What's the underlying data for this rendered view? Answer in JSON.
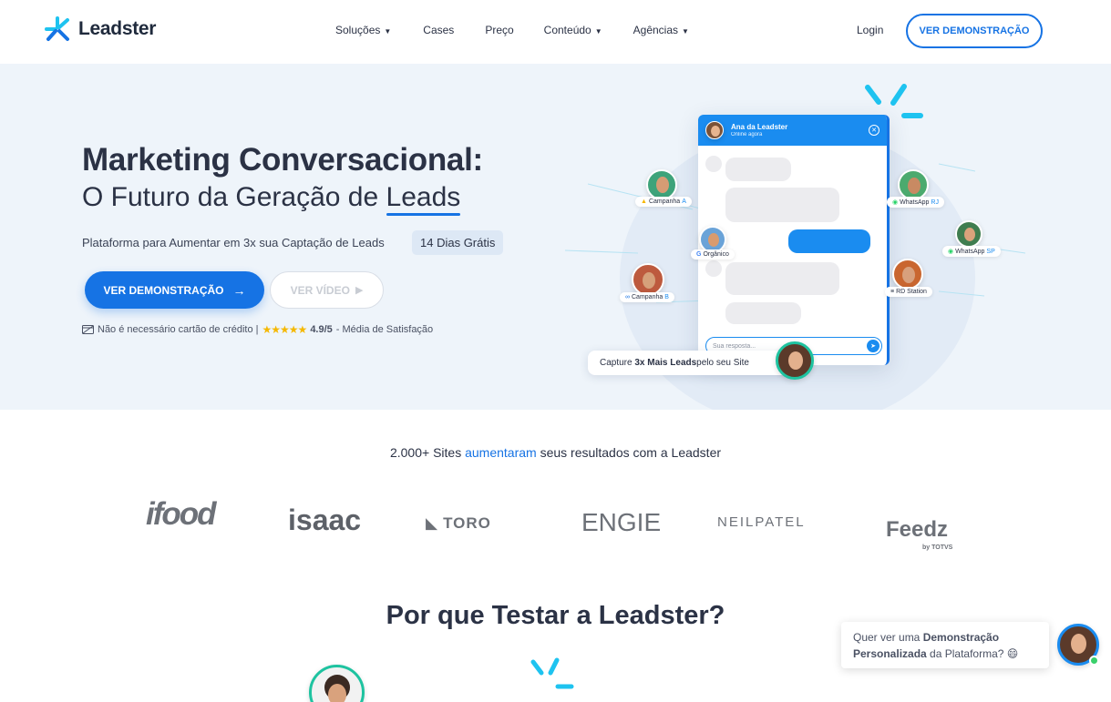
{
  "header": {
    "logo_text": "Leadster",
    "nav": [
      {
        "label": "Soluções",
        "dropdown": true
      },
      {
        "label": "Cases",
        "dropdown": false
      },
      {
        "label": "Preço",
        "dropdown": false
      },
      {
        "label": "Conteúdo",
        "dropdown": true
      },
      {
        "label": "Agências",
        "dropdown": true
      }
    ],
    "login": "Login",
    "demo_button": "VER DEMONSTRAÇÃO"
  },
  "hero": {
    "title_line1": "Marketing Conversacional:",
    "title_line2_prefix": "O Futuro da Geração de ",
    "title_line2_highlight": "Leads",
    "subtitle": "Plataforma para Aumentar em 3x sua Captação de Leads",
    "badge": "14 Dias Grátis",
    "primary_button": "VER DEMONSTRAÇÃO",
    "secondary_button": "VER VÍDEO",
    "trust_text": "Não é necessário cartão de crédito |",
    "rating": "4.9/5",
    "rating_suffix": "- Média de Satisfação"
  },
  "chat_widget": {
    "agent_name": "Ana da Leadster",
    "agent_status": "Online agora",
    "input_placeholder": "Sua resposta...",
    "cta_prefix": "Capture ",
    "cta_bold": "3x Mais Leads",
    "cta_suffix": " pelo seu Site"
  },
  "sources": [
    {
      "label": "Campanha",
      "suffix": "A"
    },
    {
      "label": "Orgânico",
      "suffix": ""
    },
    {
      "label": "Campanha",
      "suffix": "B"
    },
    {
      "label": "WhatsApp",
      "suffix": "RJ"
    },
    {
      "label": "WhatsApp",
      "suffix": "SP"
    },
    {
      "label": "RD Station",
      "suffix": ""
    }
  ],
  "logos": {
    "heading_prefix": "2.000+ Sites ",
    "heading_highlight": "aumentaram",
    "heading_suffix": " seus resultados com a Leadster",
    "items": [
      "ifood",
      "isaac",
      "TORO",
      "ENGIE",
      "NEILPATEL",
      "Feedz",
      "by TOTVS"
    ]
  },
  "why": {
    "title": "Por que Testar a Leadster?"
  },
  "popup": {
    "line1_prefix": "Quer ver uma ",
    "line1_bold": "Demonstração",
    "line2_bold": "Personalizada",
    "line2_suffix": " da Plataforma? 😄"
  },
  "colors": {
    "brand_blue": "#1673e4",
    "hero_bg": "#eef4fa",
    "accent_cyan": "#1ec3f0"
  }
}
